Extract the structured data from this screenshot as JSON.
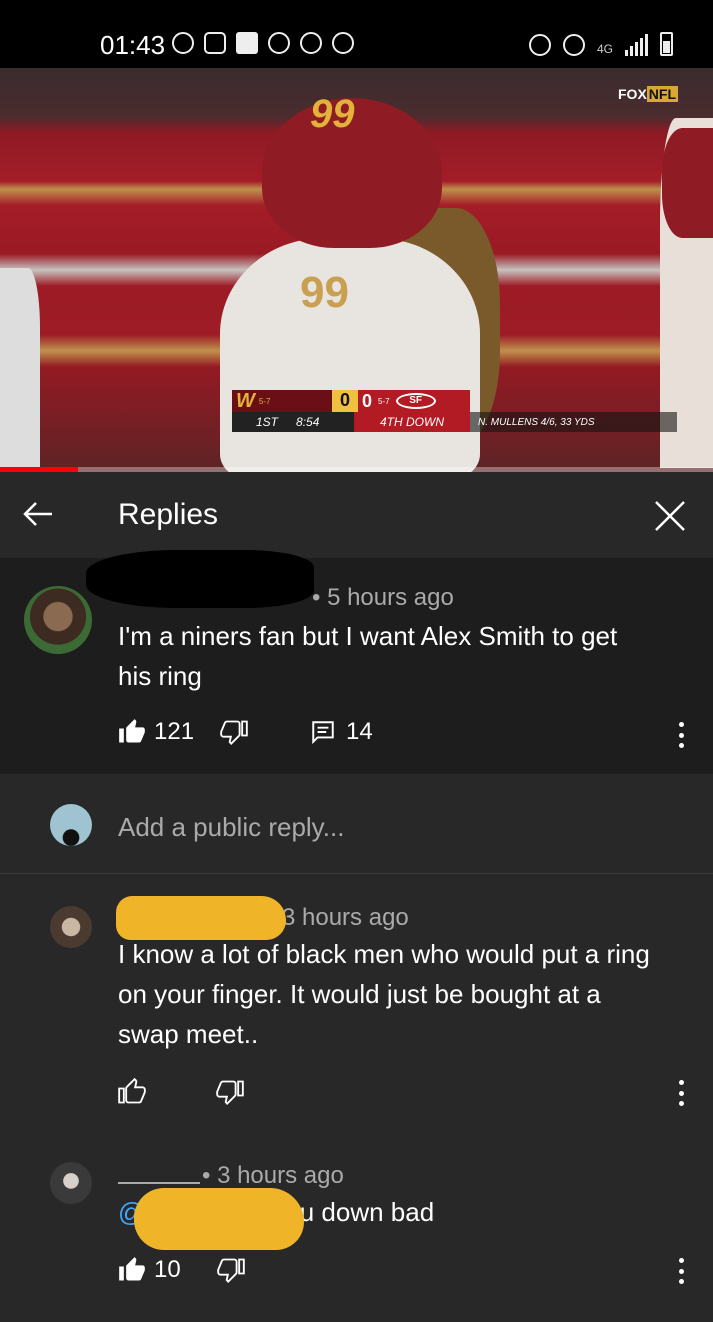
{
  "status_bar": {
    "time": "01:43",
    "network": "4G"
  },
  "video": {
    "channel_logo_fox": "FOX",
    "channel_logo_nfl": "NFL",
    "helmet_number": "99",
    "jersey_number": "99",
    "scorebug": {
      "home_logo": "W",
      "home_record": "5-7",
      "home_score": "0",
      "away_score": "0",
      "away_record": "5-7",
      "away_logo": "SF",
      "quarter": "1ST",
      "clock": "8:54",
      "down": "4TH DOWN",
      "stat": "N. MULLENS 4/6, 33 YDS"
    },
    "progress_fraction": 0.11
  },
  "header": {
    "title": "Replies",
    "back_icon": "back-arrow-icon",
    "close_icon": "close-icon"
  },
  "parent_comment": {
    "meta": "• 5 hours ago",
    "text_line1": "I'm a niners fan but I want Alex Smith  to get",
    "text_line2": "his ring",
    "likes": "121",
    "replies": "14"
  },
  "reply_input": {
    "placeholder": "Add a public reply..."
  },
  "replies": [
    {
      "meta": "3 hours ago",
      "text_line1": "I know a lot of black men who would put a ring",
      "text_line2": "on your finger. It would just be bought at a",
      "text_line3": "swap meet.."
    },
    {
      "meta": "• 3 hours ago",
      "mention": "@F",
      "text": "you down bad",
      "likes": "10"
    }
  ],
  "colors": {
    "background": "#282828",
    "highlight_comment": "#1d1d1d",
    "mention": "#3ea6ff",
    "progress": "#ff0000",
    "redaction_yellow": "#f0b429"
  }
}
